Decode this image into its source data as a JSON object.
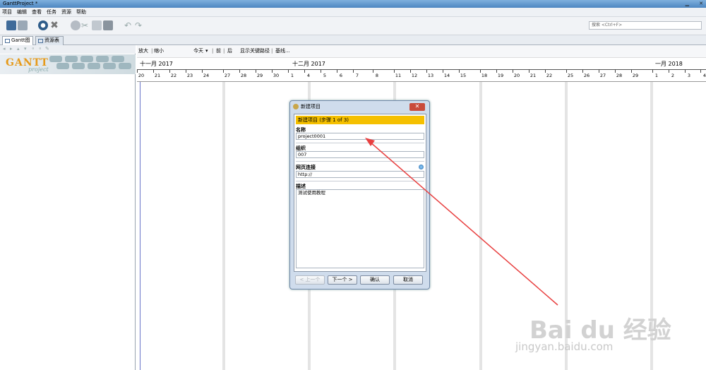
{
  "window": {
    "title": "GanttProject *"
  },
  "menu": [
    "项目",
    "编辑",
    "查看",
    "任务",
    "资源",
    "帮助"
  ],
  "search": {
    "placeholder": "搜索 <Ctrl+F>"
  },
  "tabs": [
    {
      "label": "Gantt图"
    },
    {
      "label": "资源表"
    }
  ],
  "logo": {
    "text": "GANTT",
    "sub": "project"
  },
  "gantt_toolbar": {
    "zoom_in": "放大",
    "zoom_out": "缩小",
    "today": "今天",
    "prev": "前",
    "next": "后",
    "critical_path": "显示关键路径",
    "baseline": "基线..."
  },
  "months": [
    "十一月 2017",
    "十二月 2017",
    "一月 2018"
  ],
  "days": [
    "20",
    "21",
    "22",
    "23",
    "24",
    "27",
    "28",
    "29",
    "30",
    "1",
    "4",
    "5",
    "6",
    "7",
    "8",
    "11",
    "12",
    "13",
    "14",
    "15",
    "18",
    "19",
    "20",
    "21",
    "22",
    "25",
    "26",
    "27",
    "28",
    "29",
    "1",
    "2",
    "3",
    "4"
  ],
  "dialog": {
    "title": "新建项目",
    "step": "新建项目 (步骤 1 of 3)",
    "name_label": "名称",
    "name_value": "project0001",
    "org_label": "组织",
    "org_value": "007",
    "web_label": "网页连接",
    "web_value": "http://",
    "desc_label": "描述",
    "desc_value": "测试使用教程",
    "buttons": {
      "back": "< 上一个",
      "next": "下一个 >",
      "ok": "确认",
      "cancel": "取消"
    }
  },
  "watermark": {
    "brand": "Bai du 经验",
    "url": "jingyan.baidu.com"
  },
  "colors": {
    "step_bar": "#f5c000",
    "arrow": "#e84040",
    "today_line": "#6a75c8"
  }
}
